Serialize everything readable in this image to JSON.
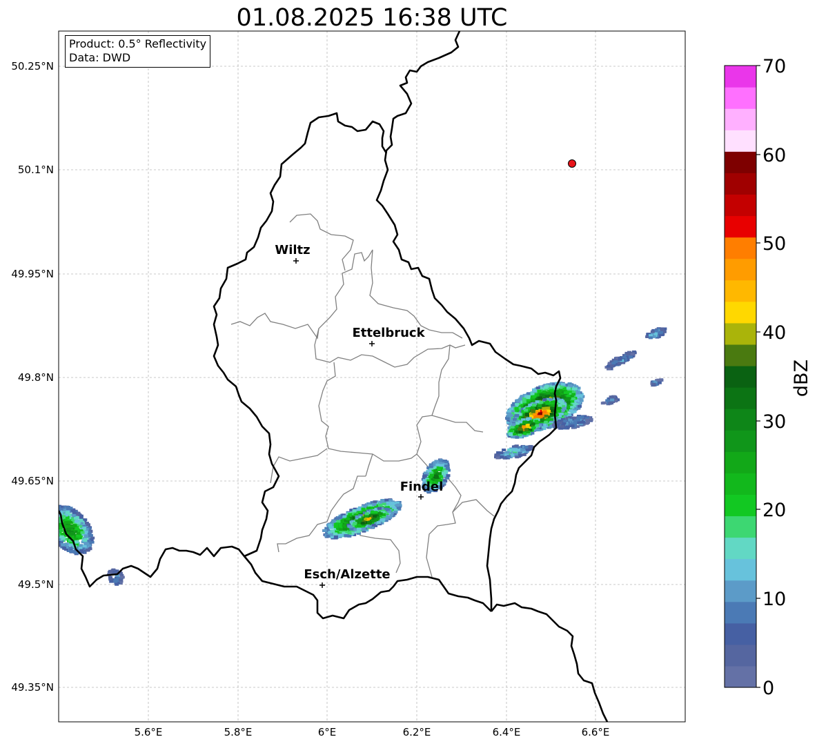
{
  "title": "01.08.2025 16:38 UTC",
  "info_box": {
    "line1": "Product: 0.5° Reflectivity",
    "line2": "Data: DWD"
  },
  "axes": {
    "lon_ticks": [
      "5.6°E",
      "5.8°E",
      "6°E",
      "6.2°E",
      "6.4°E",
      "6.6°E"
    ],
    "lat_ticks": [
      "50.25°N",
      "50.1°N",
      "49.95°N",
      "49.8°N",
      "49.65°N",
      "49.5°N",
      "49.35°N"
    ],
    "grid": true
  },
  "cities": [
    {
      "name": "Wiltz"
    },
    {
      "name": "Ettelbruck"
    },
    {
      "name": "Findel"
    },
    {
      "name": "Esch/Alzette"
    }
  ],
  "marker": {
    "color": "#e8141a"
  },
  "colorbar": {
    "label": "dBZ",
    "ticks": [
      "0",
      "10",
      "20",
      "30",
      "40",
      "50",
      "60",
      "70"
    ],
    "colors": [
      "#6471a6",
      "#5566a0",
      "#4660a3",
      "#4b7ab5",
      "#5c9bc8",
      "#67c2dc",
      "#62d8c4",
      "#3dd772",
      "#12c822",
      "#12b81c",
      "#12a818",
      "#10961a",
      "#0e8618",
      "#0c7414",
      "#0a6212",
      "#4a7a10",
      "#aab40a",
      "#ffd800",
      "#ffb800",
      "#ff9c00",
      "#ff7e00",
      "#e80000",
      "#c40000",
      "#a00000",
      "#7e0000",
      "#ffe0ff",
      "#ffb0ff",
      "#ff70ff",
      "#ea36ea"
    ]
  }
}
